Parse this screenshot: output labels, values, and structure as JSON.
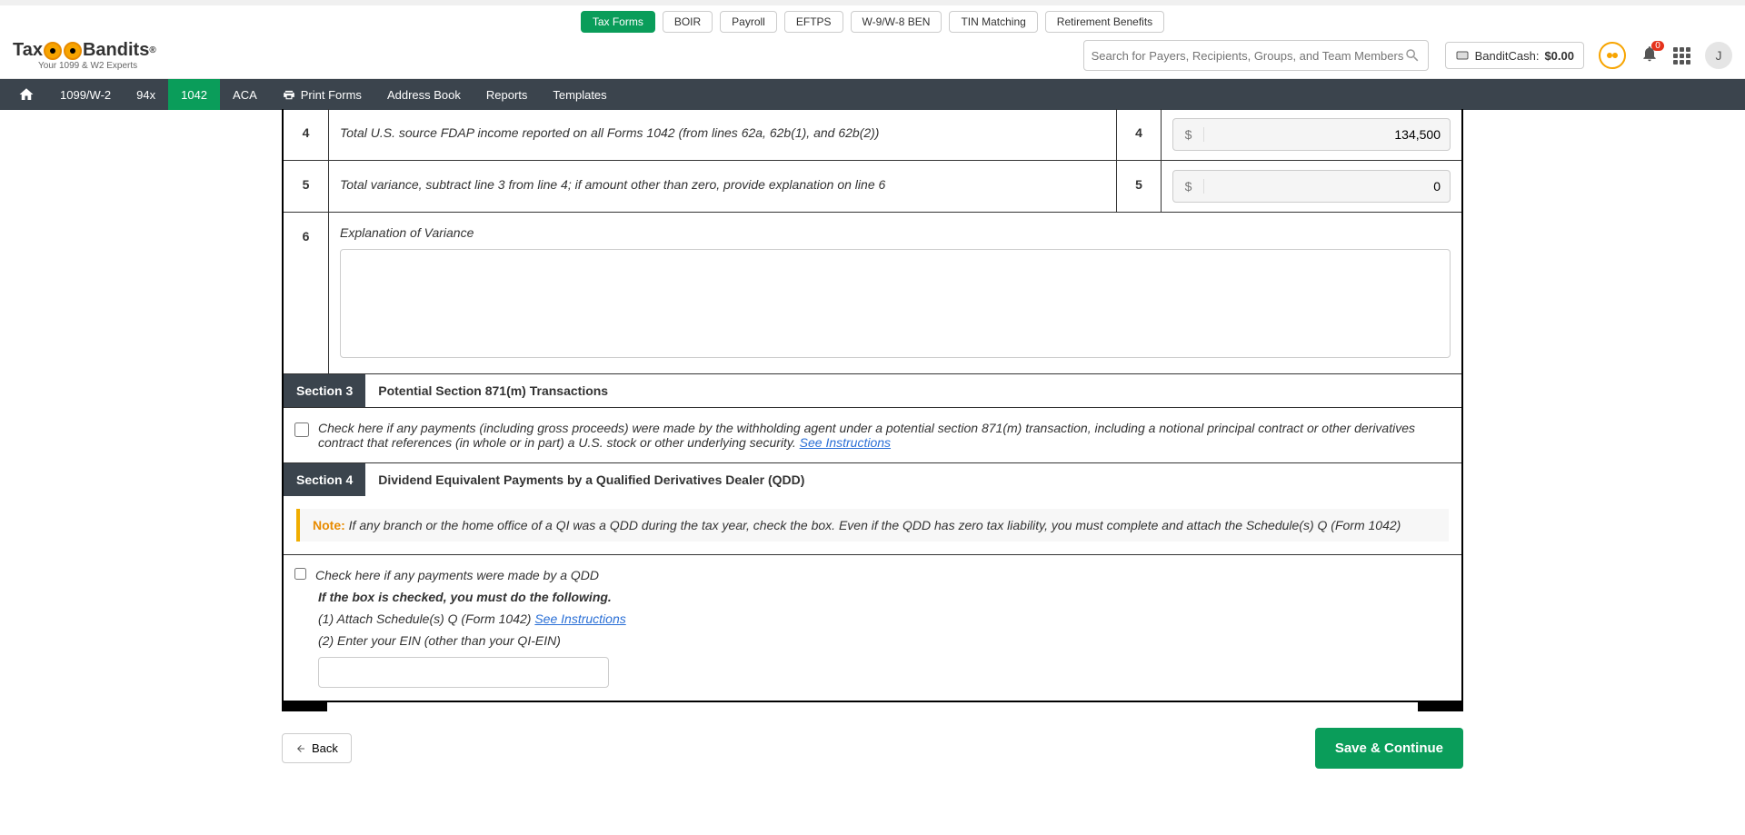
{
  "top_tabs": {
    "items": [
      "Tax Forms",
      "BOIR",
      "Payroll",
      "EFTPS",
      "W-9/W-8 BEN",
      "TIN Matching",
      "Retirement Benefits"
    ],
    "active_index": 0
  },
  "logo": {
    "prefix": "Tax",
    "suffix": "Bandits",
    "reg": "®",
    "tagline": "Your 1099 & W2 Experts"
  },
  "search": {
    "placeholder": "Search for Payers, Recipients, Groups, and Team Members"
  },
  "bandit_cash": {
    "label": "BanditCash:",
    "amount": "$0.00"
  },
  "notifications": {
    "count": "0"
  },
  "avatar": {
    "initial": "J"
  },
  "nav": {
    "items": [
      "1099/W-2",
      "94x",
      "1042",
      "ACA",
      "Print Forms",
      "Address Book",
      "Reports",
      "Templates"
    ],
    "active_index": 2
  },
  "form": {
    "row4": {
      "num": "4",
      "desc": "Total U.S. source FDAP income reported on all Forms 1042 (from lines 62a, 62b(1), and 62b(2))",
      "num2": "4",
      "value": "134,500"
    },
    "row5": {
      "num": "5",
      "desc": "Total variance, subtract line 3 from line 4; if amount other than zero, provide explanation on line 6",
      "num2": "5",
      "value": "0"
    },
    "row6": {
      "num": "6",
      "desc": "Explanation of Variance",
      "value": ""
    },
    "section3": {
      "tag": "Section 3",
      "title": "Potential Section 871(m) Transactions",
      "checkbox_text": "Check here if any payments (including gross proceeds) were made by the withholding agent under a potential section 871(m) transaction, including a notional principal contract or other derivatives contract that references (in whole or in part) a U.S. stock or other underlying security.",
      "link": "See Instructions"
    },
    "section4": {
      "tag": "Section 4",
      "title": "Dividend Equivalent Payments by a Qualified Derivatives Dealer (QDD)",
      "note_label": "Note:",
      "note_text": "If any branch or the home office of a QI was a QDD during the tax year, check the box. Even if the QDD has zero tax liability, you must complete and attach the Schedule(s) Q (Form 1042)",
      "checkbox_text": "Check here if any payments were made by a QDD",
      "if_checked": "If the box is checked, you must do the following.",
      "attach_line": "(1) Attach Schedule(s) Q (Form 1042)",
      "attach_link": "See Instructions",
      "ein_line": "(2) Enter your EIN (other than your QI-EIN)",
      "ein_value": ""
    }
  },
  "footer": {
    "back": "Back",
    "save": "Save & Continue"
  }
}
